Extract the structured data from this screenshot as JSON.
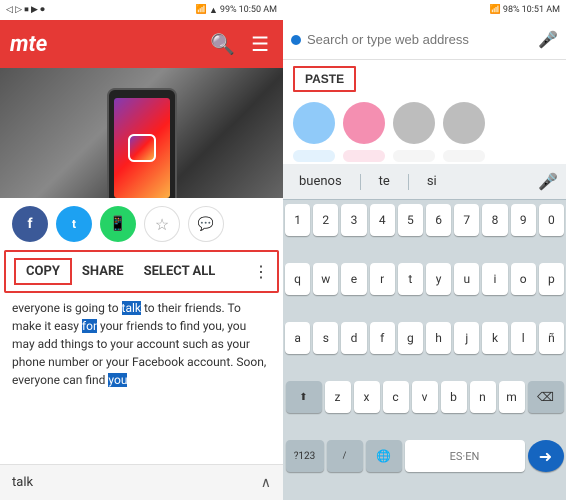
{
  "left": {
    "status_bar": {
      "time": "10:50 AM",
      "battery": "99%",
      "signal": "▲▼"
    },
    "toolbar": {
      "logo": "mte",
      "search_icon": "🔍",
      "menu_icon": "☰"
    },
    "social_buttons": [
      {
        "name": "Facebook",
        "type": "facebook",
        "icon": "f"
      },
      {
        "name": "Twitter",
        "type": "twitter",
        "icon": "t"
      },
      {
        "name": "WhatsApp",
        "type": "whatsapp",
        "icon": "w"
      },
      {
        "name": "Bookmark",
        "type": "bookmark",
        "icon": "☆"
      },
      {
        "name": "Comment",
        "type": "comment",
        "icon": "💬"
      }
    ],
    "context_menu": {
      "copy_label": "COPY",
      "share_label": "SHARE",
      "select_label": "SELECT ALL",
      "more_icon": "⋮"
    },
    "article": {
      "text1": "everyone is going to ",
      "highlight1": "talk",
      "text2": " to their friends. To make it easy ",
      "highlight2": "for",
      "text3": " your friends to find you, you may add things to your account such as your phone number or your Facebook account. Soon, everyone can find ",
      "highlight3": "you"
    },
    "bottom_bar": {
      "text": "talk",
      "arrow": "∧"
    }
  },
  "right": {
    "status_bar": {
      "time": "10:51 AM",
      "battery": "98%"
    },
    "url_bar": {
      "placeholder": "Search or type web address",
      "mic_icon": "🎤"
    },
    "paste_button": "PASTE",
    "keyboard": {
      "suggestions": [
        "buenos",
        "te",
        "si"
      ],
      "rows": [
        [
          "1",
          "2",
          "3",
          "4",
          "5",
          "6",
          "7",
          "8",
          "9",
          "0"
        ],
        [
          "q",
          "w",
          "e",
          "r",
          "t",
          "y",
          "u",
          "i",
          "o",
          "p"
        ],
        [
          "a",
          "s",
          "d",
          "f",
          "g",
          "h",
          "j",
          "k",
          "l",
          "ñ"
        ],
        [
          "z",
          "x",
          "c",
          "v",
          "b",
          "n",
          "m"
        ],
        [
          "?123",
          "/",
          "ES·EN"
        ]
      ]
    }
  }
}
